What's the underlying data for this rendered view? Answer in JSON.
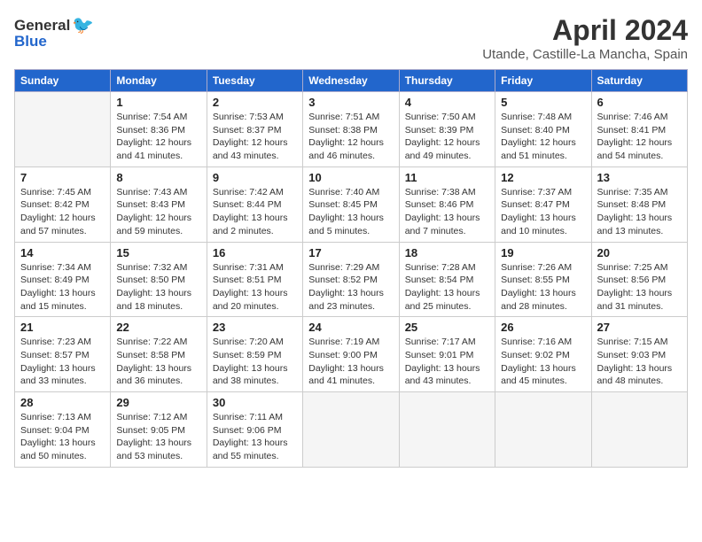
{
  "logo": {
    "general": "General",
    "blue": "Blue"
  },
  "title": "April 2024",
  "location": "Utande, Castille-La Mancha, Spain",
  "days_of_week": [
    "Sunday",
    "Monday",
    "Tuesday",
    "Wednesday",
    "Thursday",
    "Friday",
    "Saturday"
  ],
  "weeks": [
    [
      {
        "day": "",
        "info": ""
      },
      {
        "day": "1",
        "info": "Sunrise: 7:54 AM\nSunset: 8:36 PM\nDaylight: 12 hours\nand 41 minutes."
      },
      {
        "day": "2",
        "info": "Sunrise: 7:53 AM\nSunset: 8:37 PM\nDaylight: 12 hours\nand 43 minutes."
      },
      {
        "day": "3",
        "info": "Sunrise: 7:51 AM\nSunset: 8:38 PM\nDaylight: 12 hours\nand 46 minutes."
      },
      {
        "day": "4",
        "info": "Sunrise: 7:50 AM\nSunset: 8:39 PM\nDaylight: 12 hours\nand 49 minutes."
      },
      {
        "day": "5",
        "info": "Sunrise: 7:48 AM\nSunset: 8:40 PM\nDaylight: 12 hours\nand 51 minutes."
      },
      {
        "day": "6",
        "info": "Sunrise: 7:46 AM\nSunset: 8:41 PM\nDaylight: 12 hours\nand 54 minutes."
      }
    ],
    [
      {
        "day": "7",
        "info": "Sunrise: 7:45 AM\nSunset: 8:42 PM\nDaylight: 12 hours\nand 57 minutes."
      },
      {
        "day": "8",
        "info": "Sunrise: 7:43 AM\nSunset: 8:43 PM\nDaylight: 12 hours\nand 59 minutes."
      },
      {
        "day": "9",
        "info": "Sunrise: 7:42 AM\nSunset: 8:44 PM\nDaylight: 13 hours\nand 2 minutes."
      },
      {
        "day": "10",
        "info": "Sunrise: 7:40 AM\nSunset: 8:45 PM\nDaylight: 13 hours\nand 5 minutes."
      },
      {
        "day": "11",
        "info": "Sunrise: 7:38 AM\nSunset: 8:46 PM\nDaylight: 13 hours\nand 7 minutes."
      },
      {
        "day": "12",
        "info": "Sunrise: 7:37 AM\nSunset: 8:47 PM\nDaylight: 13 hours\nand 10 minutes."
      },
      {
        "day": "13",
        "info": "Sunrise: 7:35 AM\nSunset: 8:48 PM\nDaylight: 13 hours\nand 13 minutes."
      }
    ],
    [
      {
        "day": "14",
        "info": "Sunrise: 7:34 AM\nSunset: 8:49 PM\nDaylight: 13 hours\nand 15 minutes."
      },
      {
        "day": "15",
        "info": "Sunrise: 7:32 AM\nSunset: 8:50 PM\nDaylight: 13 hours\nand 18 minutes."
      },
      {
        "day": "16",
        "info": "Sunrise: 7:31 AM\nSunset: 8:51 PM\nDaylight: 13 hours\nand 20 minutes."
      },
      {
        "day": "17",
        "info": "Sunrise: 7:29 AM\nSunset: 8:52 PM\nDaylight: 13 hours\nand 23 minutes."
      },
      {
        "day": "18",
        "info": "Sunrise: 7:28 AM\nSunset: 8:54 PM\nDaylight: 13 hours\nand 25 minutes."
      },
      {
        "day": "19",
        "info": "Sunrise: 7:26 AM\nSunset: 8:55 PM\nDaylight: 13 hours\nand 28 minutes."
      },
      {
        "day": "20",
        "info": "Sunrise: 7:25 AM\nSunset: 8:56 PM\nDaylight: 13 hours\nand 31 minutes."
      }
    ],
    [
      {
        "day": "21",
        "info": "Sunrise: 7:23 AM\nSunset: 8:57 PM\nDaylight: 13 hours\nand 33 minutes."
      },
      {
        "day": "22",
        "info": "Sunrise: 7:22 AM\nSunset: 8:58 PM\nDaylight: 13 hours\nand 36 minutes."
      },
      {
        "day": "23",
        "info": "Sunrise: 7:20 AM\nSunset: 8:59 PM\nDaylight: 13 hours\nand 38 minutes."
      },
      {
        "day": "24",
        "info": "Sunrise: 7:19 AM\nSunset: 9:00 PM\nDaylight: 13 hours\nand 41 minutes."
      },
      {
        "day": "25",
        "info": "Sunrise: 7:17 AM\nSunset: 9:01 PM\nDaylight: 13 hours\nand 43 minutes."
      },
      {
        "day": "26",
        "info": "Sunrise: 7:16 AM\nSunset: 9:02 PM\nDaylight: 13 hours\nand 45 minutes."
      },
      {
        "day": "27",
        "info": "Sunrise: 7:15 AM\nSunset: 9:03 PM\nDaylight: 13 hours\nand 48 minutes."
      }
    ],
    [
      {
        "day": "28",
        "info": "Sunrise: 7:13 AM\nSunset: 9:04 PM\nDaylight: 13 hours\nand 50 minutes."
      },
      {
        "day": "29",
        "info": "Sunrise: 7:12 AM\nSunset: 9:05 PM\nDaylight: 13 hours\nand 53 minutes."
      },
      {
        "day": "30",
        "info": "Sunrise: 7:11 AM\nSunset: 9:06 PM\nDaylight: 13 hours\nand 55 minutes."
      },
      {
        "day": "",
        "info": ""
      },
      {
        "day": "",
        "info": ""
      },
      {
        "day": "",
        "info": ""
      },
      {
        "day": "",
        "info": ""
      }
    ]
  ]
}
